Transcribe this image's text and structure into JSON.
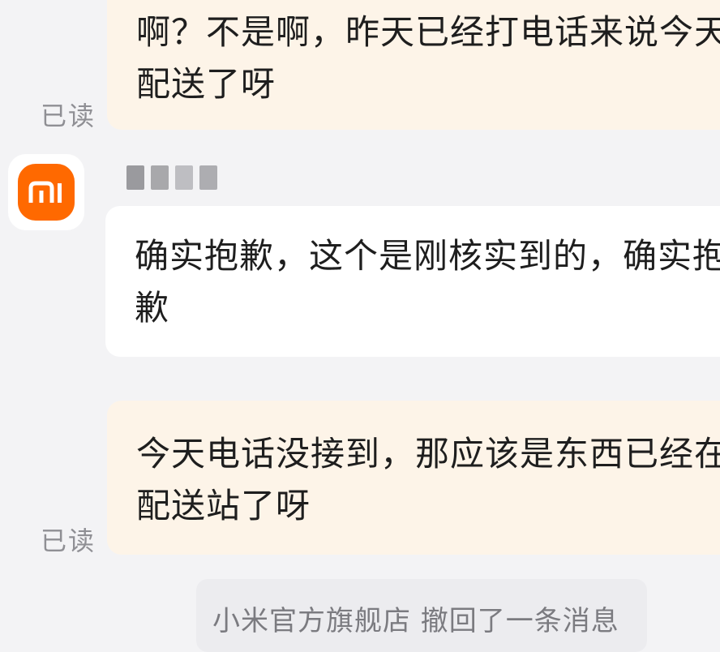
{
  "messages": [
    {
      "direction": "outgoing",
      "text": "啊？不是啊，昨天已经打电话来说今天配送了呀",
      "status": "已读"
    },
    {
      "direction": "incoming",
      "sender_logo_text": "mi",
      "text": "确实抱歉，这个是刚核实到的，确实抱歉"
    },
    {
      "direction": "outgoing",
      "text": "今天电话没接到，那应该是东西已经在配送站了呀",
      "status": "已读"
    }
  ],
  "system_notice": "小米官方旗舰店 撤回了一条消息",
  "colors": {
    "page_background": "#f3f3f5",
    "outgoing_bubble": "#fdf4e8",
    "incoming_bubble": "#ffffff",
    "brand_orange": "#ff6900",
    "read_receipt": "#8f8f94"
  },
  "icons": {
    "avatar": "xiaomi-logo-icon"
  }
}
